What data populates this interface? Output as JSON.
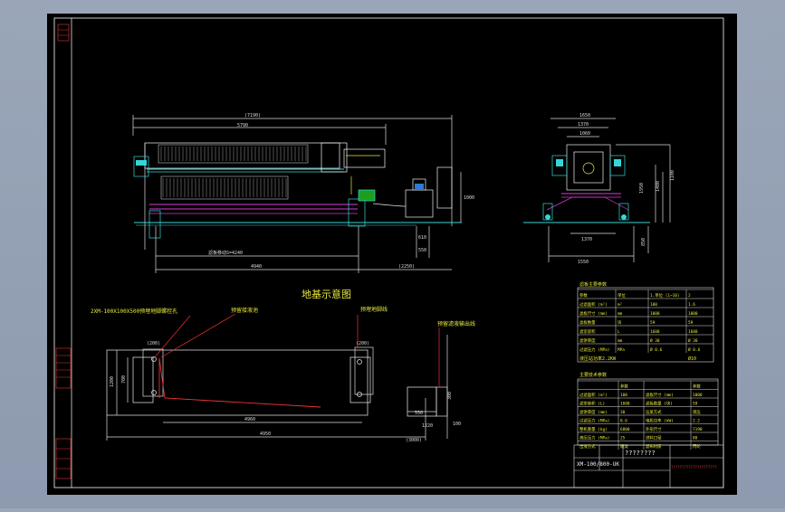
{
  "drawing": {
    "title_cn": "地基示意图",
    "drawing_no": "XM-100/800-UK",
    "title_text": "????????",
    "red_note": "?????????????????????"
  },
  "dims": {
    "top_overall": "(7190)",
    "top_main": "5790",
    "plate_span": "滤板移动S=4240",
    "base_left": "4940",
    "base_right": "(2250)",
    "height_right": "1000",
    "small_a": "610",
    "small_b": "550",
    "side_top": "1650",
    "side_top2": "1370",
    "side_sub": "1060",
    "side_h1": "1950",
    "side_h2": "1400",
    "side_h3": "1100",
    "side_bottom": "1370",
    "side_bottom2": "1550",
    "side_right": "850"
  },
  "foundation": {
    "label_bolts": "2XM-100X100X500预埋地脚螺栓孔",
    "label_sump": "预留接液池",
    "label_right": "预埋地脚线",
    "label_far": "预留滤液输出线",
    "dim_left_tag": "(200)",
    "dim_right_tag": "(200)",
    "dim_inner": "4960",
    "dim_total": "4950",
    "dim_pump": "(3000)",
    "dim_h1": "1200",
    "dim_h2": "700",
    "dim_pump_w": "550",
    "dim_pump_h": "1220",
    "dim_pump_a": "300",
    "dim_pump_b": "100"
  },
  "tech": {
    "title": "滤板主要参数",
    "header": [
      "参数",
      "单位",
      "1.单位 (1~10)",
      "2"
    ],
    "rows": [
      [
        "过滤面积 (m²)",
        "m²",
        "100",
        "1.6"
      ],
      [
        "滤板尺寸 (mm)",
        "mm",
        "1000",
        "1000"
      ],
      [
        "滤板数量",
        "块",
        "59",
        "59"
      ],
      [
        "滤室容积",
        "L",
        "1600",
        "1600"
      ],
      [
        "滤饼厚度",
        "mm",
        "Ø 30",
        "Ø 30"
      ],
      [
        "过滤压力 (MPa)",
        "MPa",
        "Ø 0.6",
        "Ø 0.6"
      ]
    ],
    "note": "液压站功率2.2KW",
    "note2": "Ø10"
  },
  "params": {
    "title": "主要技术参数",
    "header": [
      "",
      "参数",
      "",
      "参数"
    ],
    "rows": [
      [
        "过滤面积 (m²)",
        "100",
        "滤板尺寸 (mm)",
        "1000"
      ],
      [
        "滤室容积 (L)",
        "1600",
        "滤板数量 (块)",
        "59"
      ],
      [
        "滤饼厚度 (mm)",
        "30",
        "压紧方式",
        "液压"
      ],
      [
        "过滤压力 (MPa)",
        "0.6",
        "电机功率 (kW)",
        "2.2"
      ],
      [
        "整机重量 (kg)",
        "6800",
        "外形尺寸",
        "7190"
      ],
      [
        "液压压力 (MPa)",
        "25",
        "进料口径",
        "80"
      ],
      [
        "出液方式",
        "明流",
        "滤布材质",
        "丙纶"
      ]
    ]
  },
  "frame": {
    "left_tags": [
      "XXX",
      "XXX",
      "XXX"
    ],
    "border_color": "#e8e8e8",
    "bg": "#000000"
  }
}
